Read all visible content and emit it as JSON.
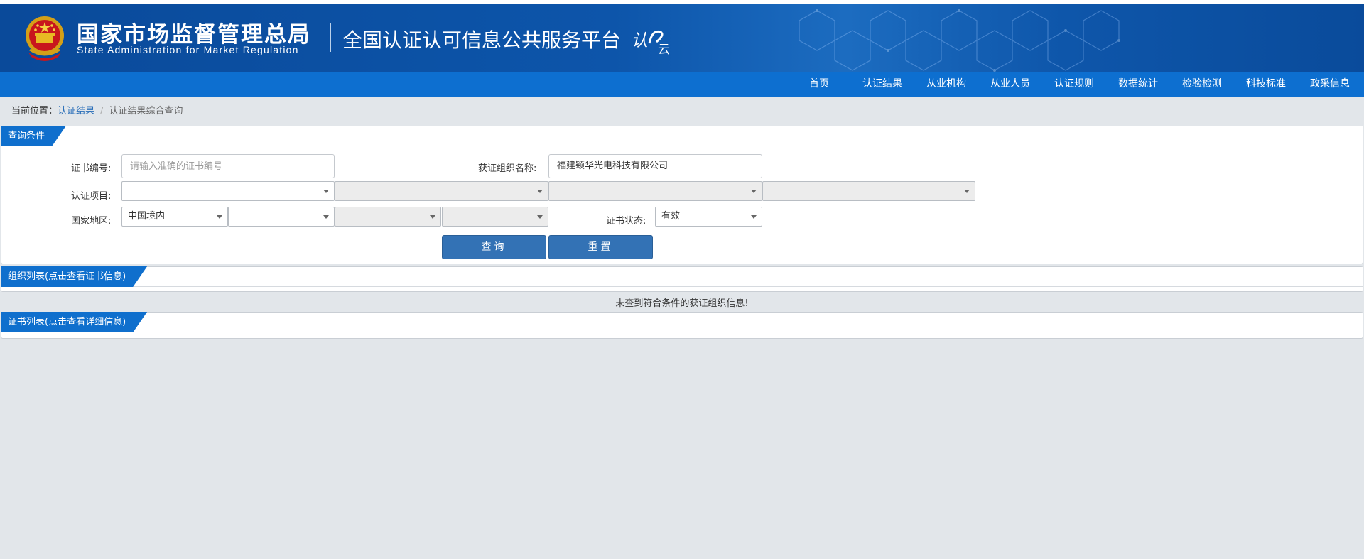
{
  "header": {
    "org_cn": "国家市场监督管理总局",
    "org_en": "State Administration  for  Market Regulation",
    "platform": "全国认证认可信息公共服务平台",
    "logo_text": "认云"
  },
  "nav": {
    "items": [
      "首页",
      "认证结果",
      "从业机构",
      "从业人员",
      "认证规则",
      "数据统计",
      "检验检测",
      "科技标准",
      "政采信息"
    ]
  },
  "breadcrumb": {
    "prefix": "当前位置：",
    "link": "认证结果",
    "current": "认证结果综合查询"
  },
  "query": {
    "title": "查询条件",
    "cert_no_label": "证书编号:",
    "cert_no_placeholder": "请输入准确的证书编号",
    "org_name_label": "获证组织名称:",
    "org_name_value": "福建颖华光电科技有限公司",
    "project_label": "认证项目:",
    "project_selects": [
      "",
      "",
      "",
      ""
    ],
    "region_label": "国家地区:",
    "region_selects": [
      "中国境内",
      "",
      "",
      ""
    ],
    "status_label": "证书状态:",
    "status_value": "有效",
    "search_button": "查询",
    "reset_button": "重置"
  },
  "org_list": {
    "title": "组织列表(点击查看证书信息)",
    "empty_message": "未查到符合条件的获证组织信息!"
  },
  "cert_list": {
    "title": "证书列表(点击查看详细信息)"
  },
  "colors": {
    "header_blue": "#0a4a9a",
    "nav_blue": "#0d6fd0",
    "button_blue": "#3372b5",
    "page_bg": "#e2e6ea"
  }
}
